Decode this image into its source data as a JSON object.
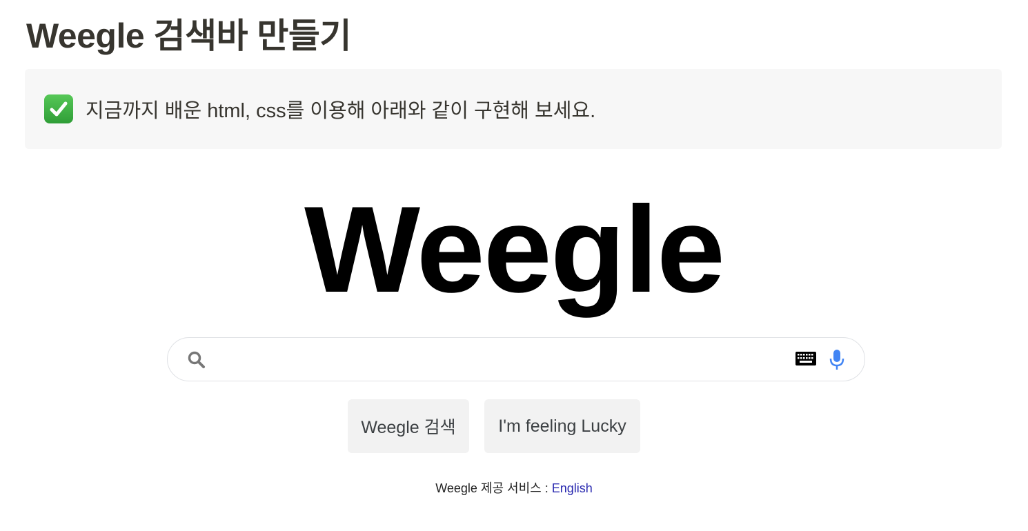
{
  "page": {
    "title": "Weegle 검색바 만들기"
  },
  "callout": {
    "icon": "check-mark-button-icon",
    "text": "지금까지 배운 html, css를 이용해 아래와 같이 구현해 보세요."
  },
  "logo": {
    "text": "Weegle"
  },
  "search": {
    "value": "",
    "placeholder": "",
    "icons": [
      "search-icon",
      "keyboard-icon",
      "microphone-icon"
    ],
    "mic_color": "#4285f4"
  },
  "buttons": {
    "search_label": "Weegle 검색",
    "lucky_label": "I'm feeling Lucky"
  },
  "footer": {
    "prefix": "Weegle 제공 서비스 : ",
    "link_label": "English",
    "link_color": "#2a2ab0"
  }
}
